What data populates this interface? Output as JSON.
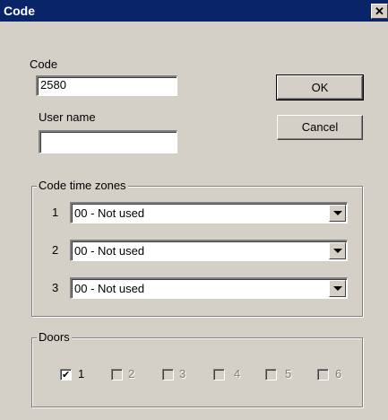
{
  "window": {
    "title": "Code",
    "close_glyph": "✕"
  },
  "form": {
    "code_label": "Code",
    "code_value": "2580",
    "user_name_label": "User name",
    "user_name_value": ""
  },
  "buttons": {
    "ok_label": "OK",
    "cancel_label": "Cancel"
  },
  "time_zones": {
    "caption": "Code time zones",
    "rows": [
      {
        "number": "1",
        "value": "00 - Not used"
      },
      {
        "number": "2",
        "value": "00 - Not used"
      },
      {
        "number": "3",
        "value": "00 - Not used"
      }
    ]
  },
  "doors": {
    "caption": "Doors",
    "items": [
      {
        "label": "1",
        "checked": true,
        "enabled": true
      },
      {
        "label": "2",
        "checked": false,
        "enabled": false
      },
      {
        "label": "3",
        "checked": false,
        "enabled": false
      },
      {
        "label": "4",
        "checked": false,
        "enabled": false
      },
      {
        "label": "5",
        "checked": false,
        "enabled": false
      },
      {
        "label": "6",
        "checked": false,
        "enabled": false
      }
    ],
    "check_glyph": "✔"
  },
  "colors": {
    "titlebar": "#0a246a",
    "face": "#d4d0c8"
  }
}
